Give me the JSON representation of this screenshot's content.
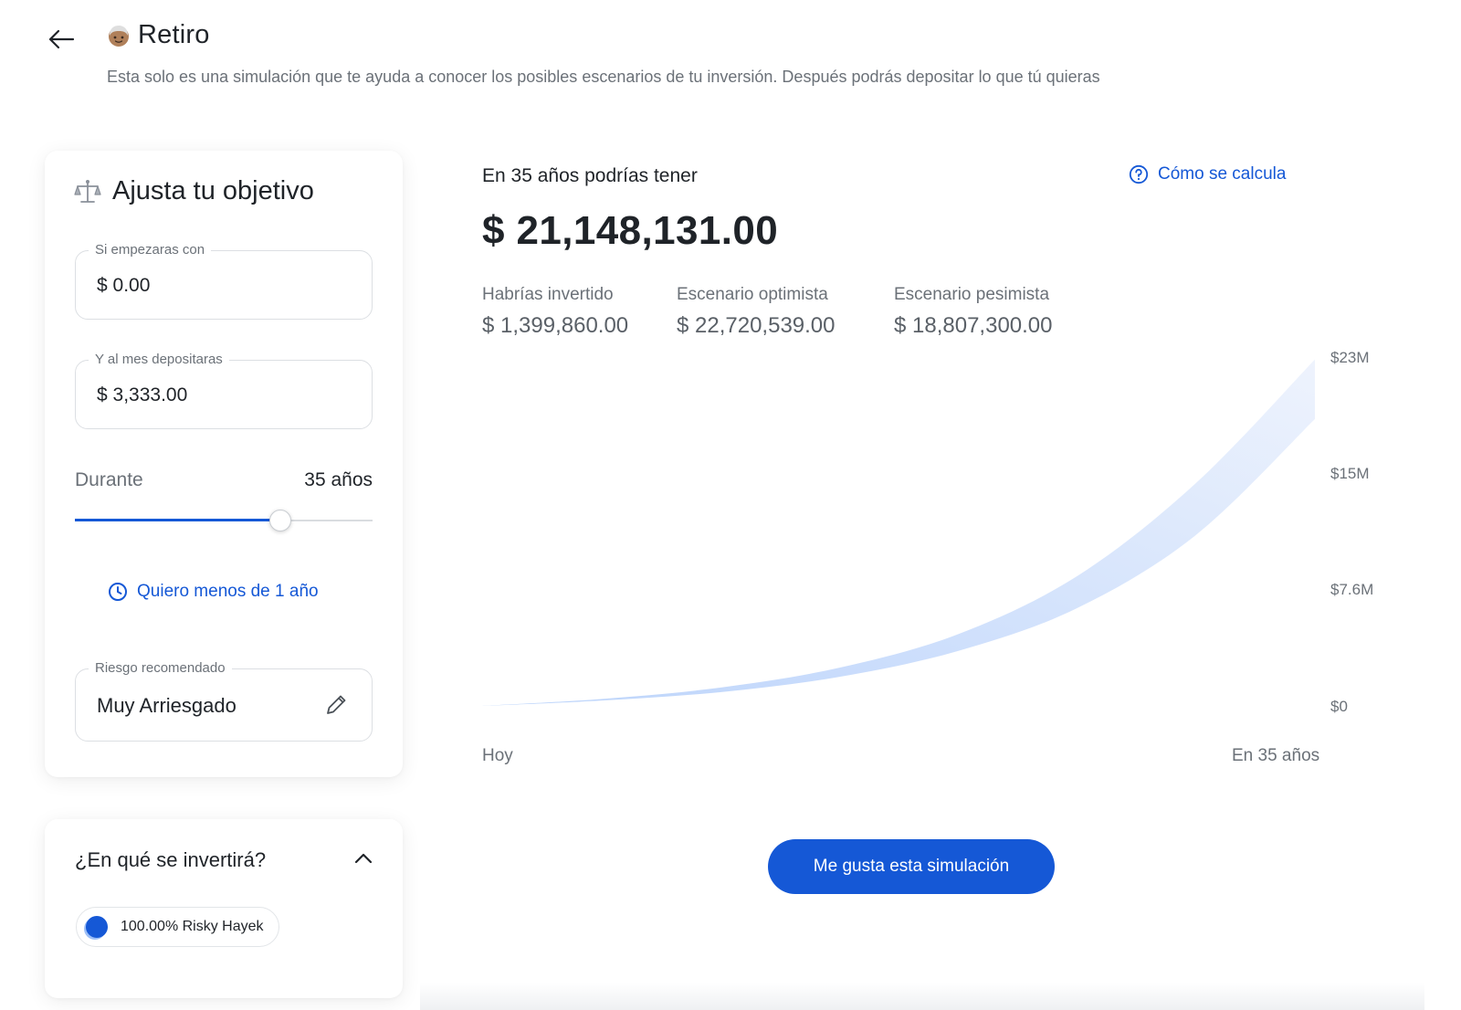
{
  "header": {
    "title": "Retiro",
    "subtitle": "Esta solo es una simulación que te ayuda a conocer los posibles escenarios de tu inversión. Después podrás depositar lo que tú quieras"
  },
  "goal_card": {
    "title": "Ajusta tu objetivo",
    "initial_amount": {
      "label": "Si empezaras con",
      "value": "$ 0.00"
    },
    "monthly_deposit": {
      "label": "Y al mes depositaras",
      "value": "$ 3,333.00"
    },
    "duration": {
      "label": "Durante",
      "value": "35 años",
      "slider_fraction": 0.69
    },
    "less_than_year_link": "Quiero menos de 1 año",
    "risk": {
      "label": "Riesgo recomendado",
      "value": "Muy Arriesgado"
    }
  },
  "invest_card": {
    "title": "¿En qué se invertirá?",
    "chip": "100.00% Risky Hayek"
  },
  "result": {
    "headline": "En 35 años podrías tener",
    "calc_link": "Cómo se calcula",
    "amount": "$ 21,148,131.00",
    "stats": [
      {
        "label": "Habrías invertido",
        "value": "$ 1,399,860.00"
      },
      {
        "label": "Escenario optimista",
        "value": "$ 22,720,539.00"
      },
      {
        "label": "Escenario pesimista",
        "value": "$ 18,807,300.00"
      }
    ]
  },
  "chart_data": {
    "type": "area",
    "x_labels": [
      "Hoy",
      "En 35 años"
    ],
    "y_ticks": [
      "$23M",
      "$15M",
      "$7.6M",
      "$0"
    ],
    "ylim": [
      0,
      22.8
    ],
    "x": [
      0,
      5,
      10,
      15,
      20,
      25,
      30,
      35
    ],
    "series": [
      {
        "values": [
          0,
          0.35,
          0.9,
          1.9,
          3.6,
          6.4,
          11.2,
          18.8
        ]
      },
      {
        "values": [
          0,
          0.45,
          1.2,
          2.5,
          4.7,
          8.5,
          14.6,
          22.7
        ]
      }
    ]
  },
  "cta": "Me gusta esta simulación",
  "colors": {
    "accent": "#1558d6",
    "chart_light": "#eef3fd",
    "chart_dark": "#bcd4fb"
  },
  "icons": {
    "back": "arrow-left-icon",
    "title": "grandparent-emoji-icon",
    "goal": "balance-scale-icon",
    "edit": "pencil-icon",
    "clock": "clock-icon",
    "help": "question-circle-icon",
    "chevron": "chevron-up-icon"
  }
}
